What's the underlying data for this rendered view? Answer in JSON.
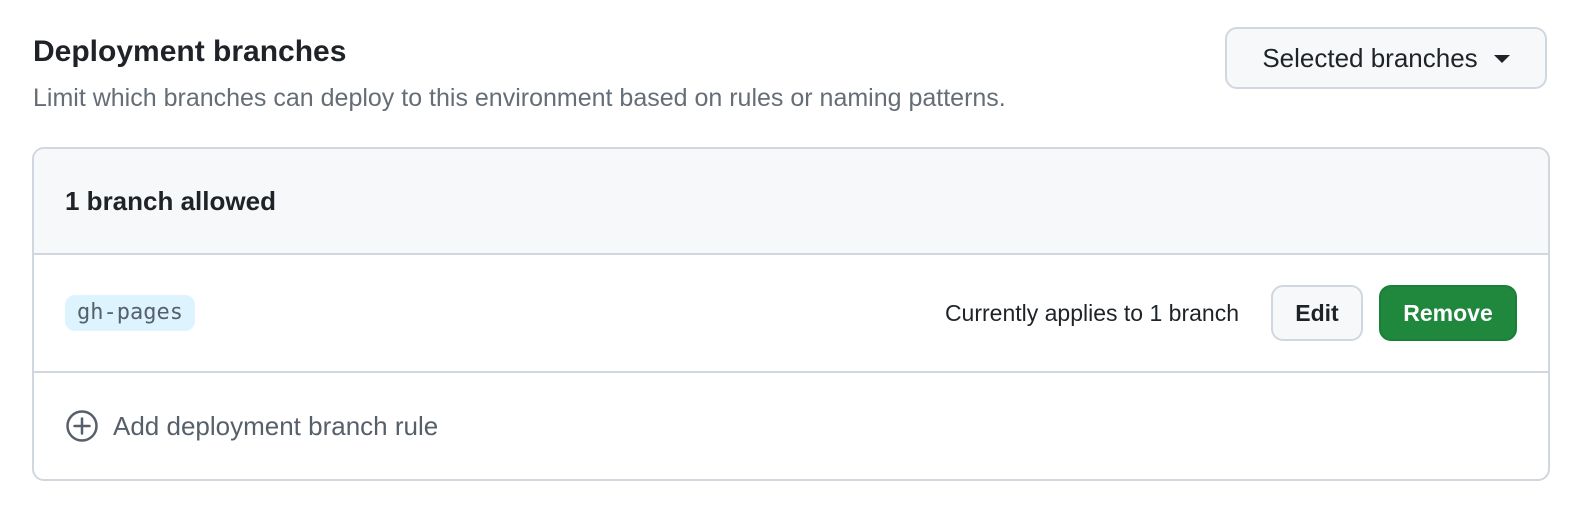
{
  "section": {
    "title": "Deployment branches",
    "description": "Limit which branches can deploy to this environment based on rules or naming patterns."
  },
  "dropdown": {
    "selected_label": "Selected branches",
    "icon": "triangle-down-icon"
  },
  "rules": {
    "header": "1 branch allowed",
    "items": [
      {
        "branch": "gh-pages",
        "applies_text": "Currently applies to 1 branch",
        "edit_label": "Edit",
        "remove_label": "Remove"
      }
    ],
    "add_label": "Add deployment branch rule",
    "add_icon": "plus-circle-icon"
  },
  "colors": {
    "accent_green": "#1f883d",
    "pill_bg": "#ddf4ff",
    "border": "#d0d7de",
    "muted_text": "#656d76"
  }
}
